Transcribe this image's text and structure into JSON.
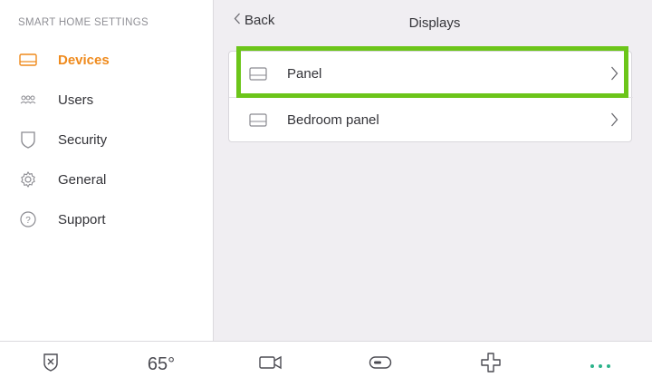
{
  "sidebar": {
    "heading": "SMART HOME SETTINGS",
    "items": [
      {
        "label": "Devices",
        "icon": "panel-icon",
        "active": true
      },
      {
        "label": "Users",
        "icon": "users-icon",
        "active": false
      },
      {
        "label": "Security",
        "icon": "shield-icon",
        "active": false
      },
      {
        "label": "General",
        "icon": "gear-icon",
        "active": false
      },
      {
        "label": "Support",
        "icon": "question-icon",
        "active": false
      }
    ]
  },
  "header": {
    "back_label": "Back",
    "title": "Displays"
  },
  "displays": {
    "rows": [
      {
        "label": "Panel",
        "icon": "panel-icon",
        "highlighted": true
      },
      {
        "label": "Bedroom panel",
        "icon": "panel-icon",
        "highlighted": false
      }
    ]
  },
  "bottom_bar": {
    "tabs": [
      {
        "icon": "security-shield-icon"
      },
      {
        "label": "65°",
        "icon": "thermostat"
      },
      {
        "icon": "camera-icon"
      },
      {
        "icon": "lock-icon"
      },
      {
        "icon": "plus-icon"
      },
      {
        "icon": "more-icon"
      }
    ]
  },
  "colors": {
    "accent": "#ef8a1c",
    "highlight": "#6cc51a",
    "more_dots": "#2bb38a"
  }
}
